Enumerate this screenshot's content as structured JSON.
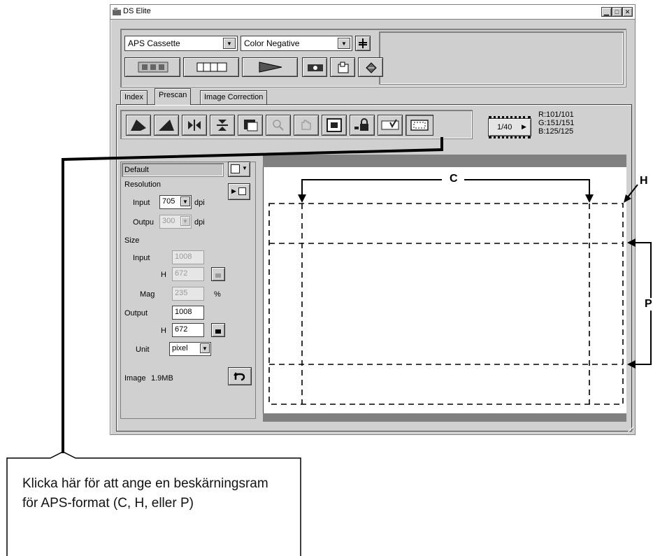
{
  "window": {
    "title": "DS Elite"
  },
  "toolbar": {
    "source_select": "APS Cassette",
    "film_type_select": "Color Negative"
  },
  "tabs": [
    {
      "label": "Index"
    },
    {
      "label": "Prescan"
    },
    {
      "label": "Image Correction"
    }
  ],
  "status": {
    "frame_counter": "1/40",
    "rgb": {
      "r": "R:101/101",
      "g": "G:151/151",
      "b": "B:125/125"
    }
  },
  "settings": {
    "preset": "Default",
    "resolution_label": "Resolution",
    "input_label": "Input",
    "input_dpi": "705",
    "dpi_unit": "dpi",
    "output_label": "Outpu",
    "output_dpi": "300",
    "size_label": "Size",
    "size_input_label": "Input",
    "size_input_w": "1008",
    "size_h_label": "H",
    "size_input_h": "672",
    "mag_label": "Mag",
    "mag_value": "235",
    "mag_unit": "%",
    "size_output_label": "Output",
    "size_output_w": "1008",
    "size_output_h": "672",
    "unit_label": "Unit",
    "unit_value": "pixel",
    "image_label": "Image",
    "image_size": "1.9MB"
  },
  "annotations": {
    "c": "C",
    "h": "H",
    "p": "P",
    "callout": "Klicka här för att ange en beskärningsram för APS-format (C, H, eller P)"
  }
}
